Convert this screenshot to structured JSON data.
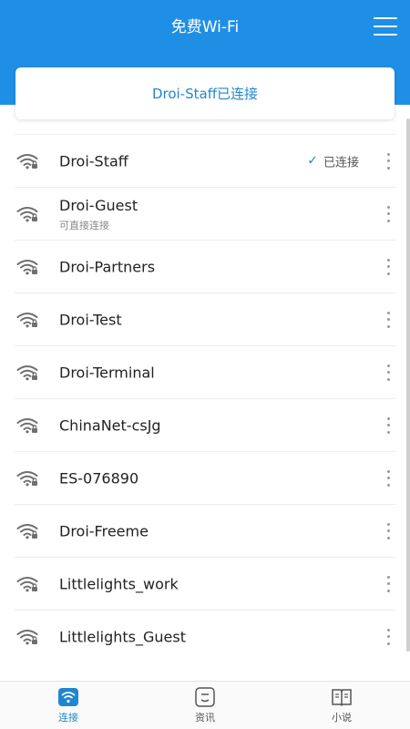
{
  "header": {
    "title": "免费Wi-Fi",
    "menu_icon": "hamburger-menu-icon",
    "background": "#1f8fe6"
  },
  "connection_card": {
    "text": "Droi-Staff已连接"
  },
  "networks": [
    {
      "name": "Droi-Staff",
      "status": "已连接",
      "sub": ""
    },
    {
      "name": "Droi-Guest",
      "status": "",
      "sub": "可直接连接"
    },
    {
      "name": "Droi-Partners",
      "status": "",
      "sub": ""
    },
    {
      "name": "Droi-Test",
      "status": "",
      "sub": ""
    },
    {
      "name": "Droi-Terminal",
      "status": "",
      "sub": ""
    },
    {
      "name": "ChinaNet-csJg",
      "status": "",
      "sub": ""
    },
    {
      "name": "ES-076890",
      "status": "",
      "sub": ""
    },
    {
      "name": "Droi-Freeme",
      "status": "",
      "sub": ""
    },
    {
      "name": "Littlelights_work",
      "status": "",
      "sub": ""
    },
    {
      "name": "Littlelights_Guest",
      "status": "",
      "sub": ""
    }
  ],
  "bottom_nav": [
    {
      "label": "连接",
      "icon": "wifi-icon",
      "active": true
    },
    {
      "label": "资讯",
      "icon": "news-icon",
      "active": false
    },
    {
      "label": "小说",
      "icon": "book-icon",
      "active": false
    }
  ],
  "colors": {
    "accent": "#1f86cf"
  }
}
